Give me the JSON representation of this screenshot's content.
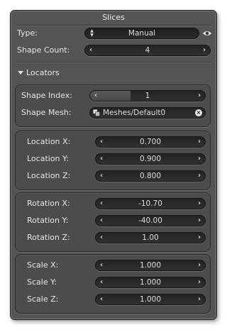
{
  "panel": {
    "title": "Slices"
  },
  "type_field": {
    "label": "Type:",
    "value": "Manual"
  },
  "shape_count": {
    "label": "Shape Count:",
    "value": "4"
  },
  "locators_header": "Locators",
  "shape_group": {
    "index": {
      "label": "Shape Index:",
      "value": "1",
      "fill_fraction": 0.35
    },
    "mesh": {
      "label": "Shape Mesh:",
      "value": "Meshes/Default0"
    }
  },
  "location": [
    {
      "label": "Location X:",
      "value": "0.700"
    },
    {
      "label": "Location Y:",
      "value": "0.900"
    },
    {
      "label": "Location Z:",
      "value": "0.800"
    }
  ],
  "rotation": [
    {
      "label": "Rotation X:",
      "value": "-10.70"
    },
    {
      "label": "Rotation Y:",
      "value": "-40.00"
    },
    {
      "label": "Rotation Z:",
      "value": "1.00"
    }
  ],
  "scale": [
    {
      "label": "Scale X:",
      "value": "1.000"
    },
    {
      "label": "Scale Y:",
      "value": "1.000"
    },
    {
      "label": "Scale Z:",
      "value": "1.000"
    }
  ],
  "arrows": {
    "left": "‹",
    "right": "›"
  },
  "colors": {
    "panel_bg": "#545454",
    "field_bg": "#262626",
    "group_bg": "#4c4c4c",
    "text": "#e6e6e6"
  }
}
